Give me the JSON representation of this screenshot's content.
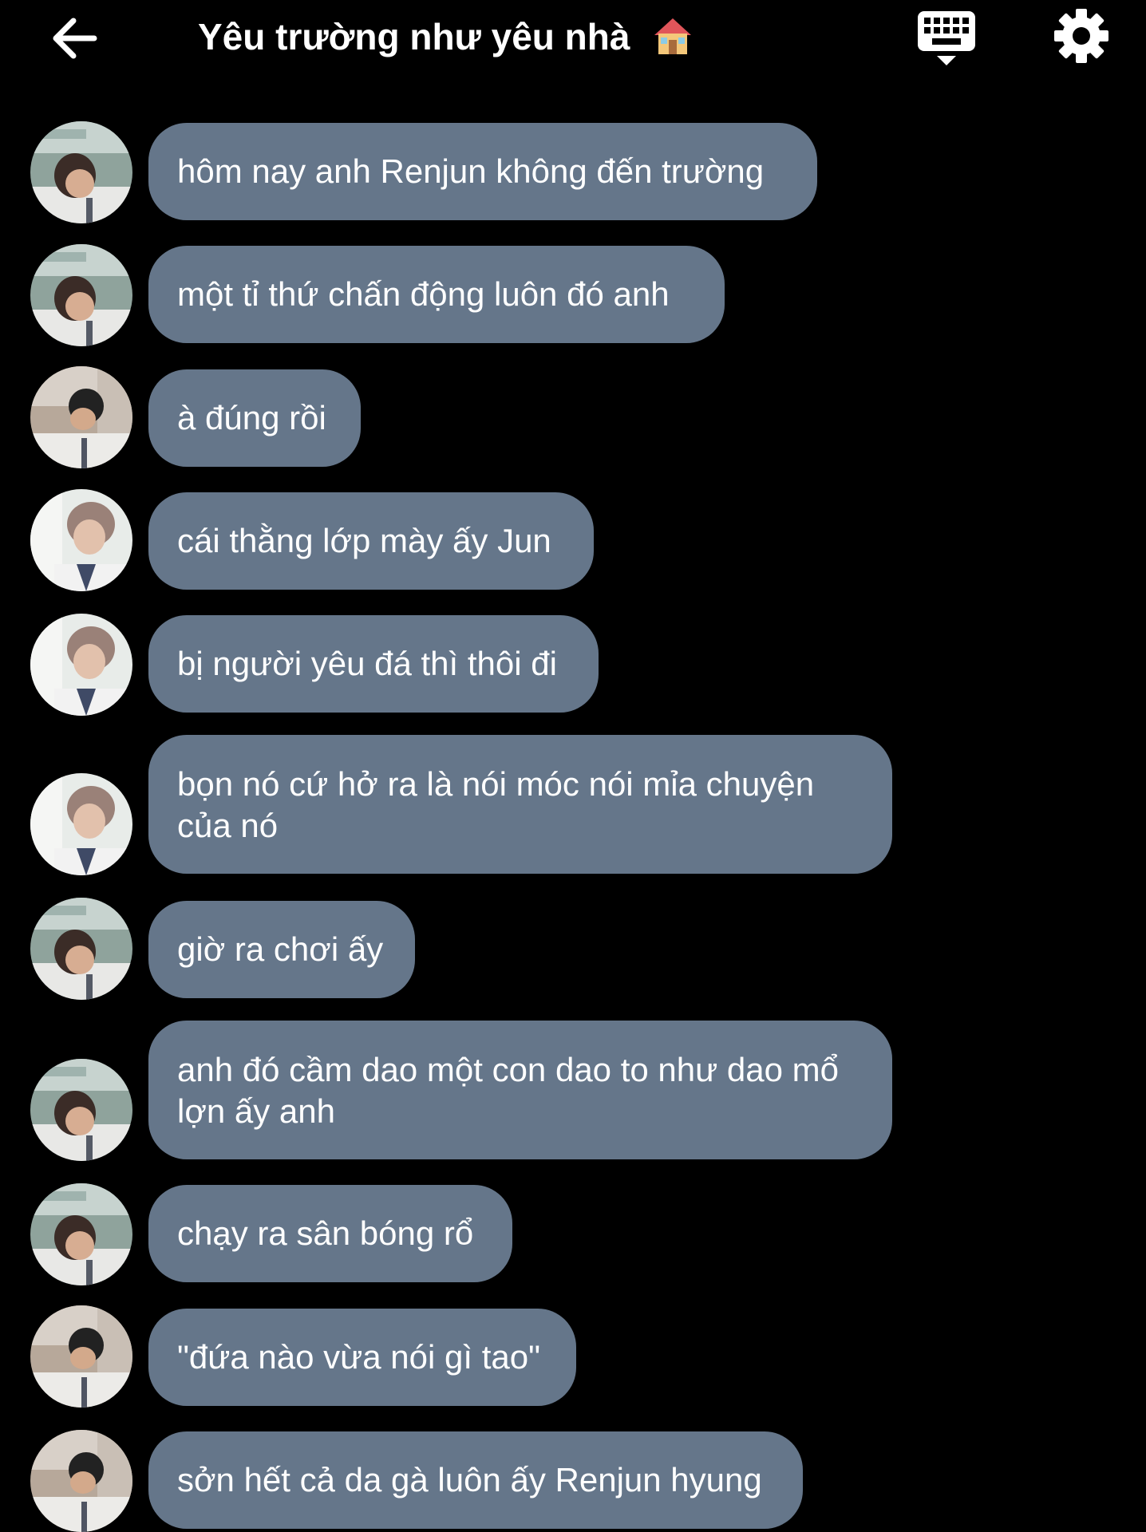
{
  "header": {
    "title": "Yêu trường như yêu nhà",
    "title_emoji": "house-icon"
  },
  "colors": {
    "background": "#000000",
    "bubble": "#65768a",
    "text": "#ffffff"
  },
  "messages": [
    {
      "avatar": "avatar-a",
      "text": "hôm nay anh Renjun không đến trường"
    },
    {
      "avatar": "avatar-a",
      "text": "một tỉ thứ chấn động luôn đó anh"
    },
    {
      "avatar": "avatar-b",
      "text": "à đúng rồi"
    },
    {
      "avatar": "avatar-c",
      "text": "cái thằng lớp mày ấy Jun"
    },
    {
      "avatar": "avatar-c",
      "text": "bị người yêu đá thì thôi đi"
    },
    {
      "avatar": "avatar-c",
      "text": "bọn nó cứ hở ra là nói móc nói mỉa chuyện của nó"
    },
    {
      "avatar": "avatar-a",
      "text": "giờ ra chơi ấy"
    },
    {
      "avatar": "avatar-a",
      "text": "anh đó cầm dao một con dao to như dao mổ lợn ấy anh"
    },
    {
      "avatar": "avatar-a",
      "text": "chạy ra sân bóng rổ"
    },
    {
      "avatar": "avatar-b",
      "text": "\"đứa nào vừa nói gì tao\""
    },
    {
      "avatar": "avatar-b",
      "text": "sởn hết cả da gà luôn ấy Renjun hyung"
    }
  ]
}
